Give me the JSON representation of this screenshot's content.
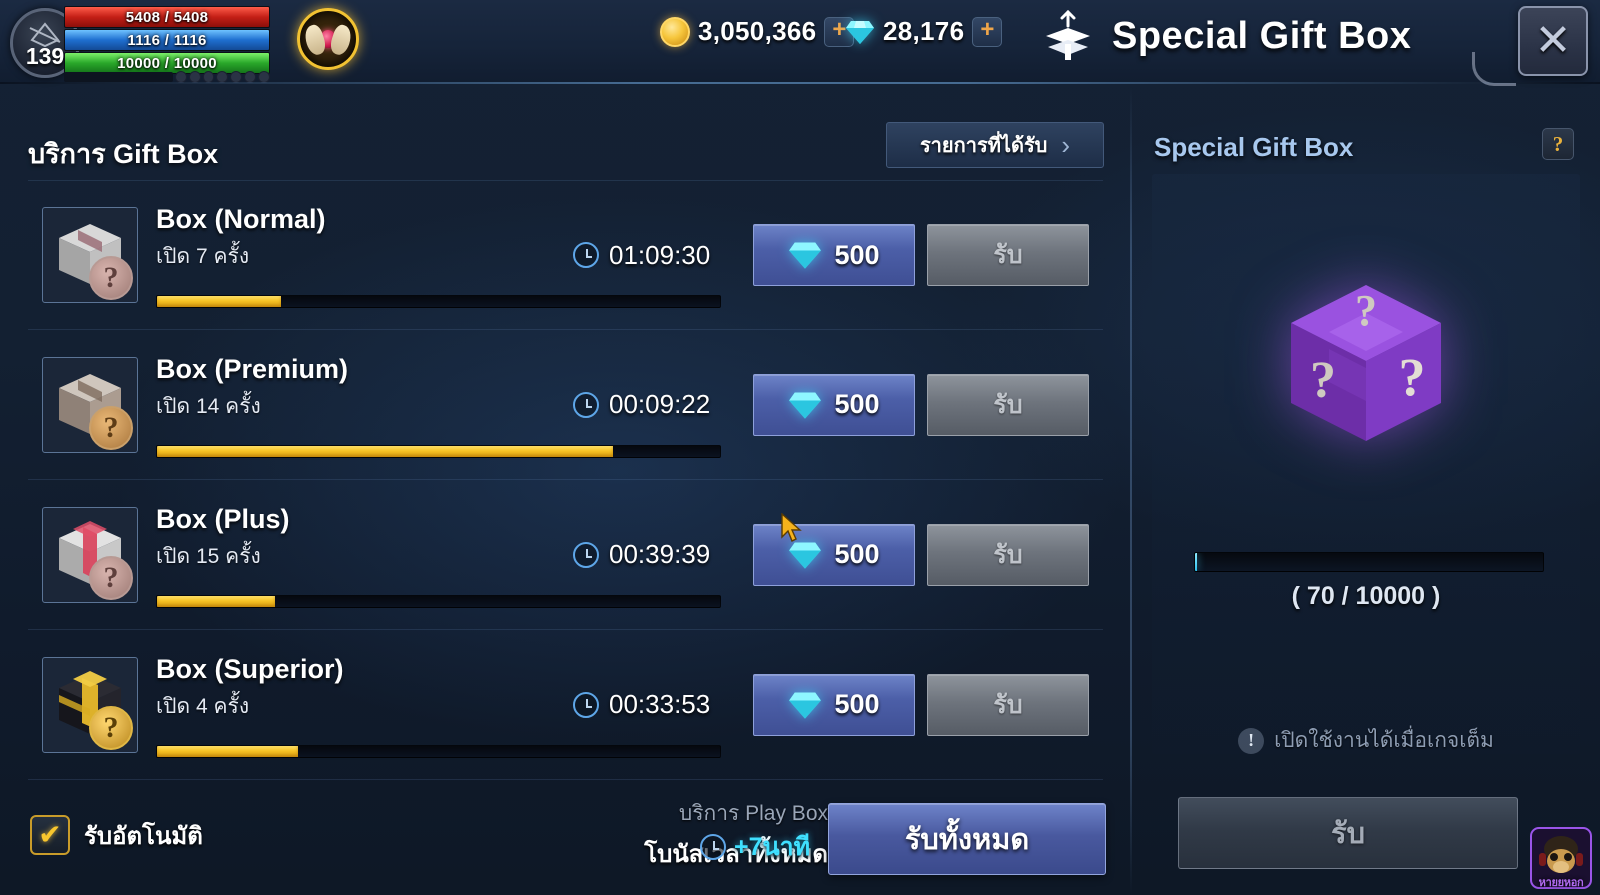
{
  "topbar": {
    "player": {
      "level": "139",
      "hp": "5408 / 5408",
      "mp": "1116 / 1116",
      "xp": "10000 / 10000"
    },
    "currencies": [
      {
        "name": "gold",
        "icon": "coin-icon",
        "value": "3,050,366",
        "plus": "+"
      },
      {
        "name": "gem",
        "icon": "gem-icon",
        "value": "28,176",
        "plus": "+"
      }
    ],
    "window_title": "Special Gift Box",
    "window_icon": "gift-box-icon",
    "close_label": "✕"
  },
  "left": {
    "section_title": "บริการ Gift Box",
    "history_button": "รายการที่ได้รับ",
    "history_chevron": "›",
    "rows": [
      {
        "name": "Box (Normal)",
        "sub": "เปิด 7 ครั้ง",
        "timer": "01:09:30",
        "price": "500",
        "claim": "รับ",
        "progress": 22,
        "box_color": "normal"
      },
      {
        "name": "Box (Premium)",
        "sub": "เปิด 14 ครั้ง",
        "timer": "00:09:22",
        "price": "500",
        "claim": "รับ",
        "progress": 81,
        "box_color": "premium"
      },
      {
        "name": "Box (Plus)",
        "sub": "เปิด 15 ครั้ง",
        "timer": "00:39:39",
        "price": "500",
        "claim": "รับ",
        "progress": 21,
        "box_color": "plus"
      },
      {
        "name": "Box (Superior)",
        "sub": "เปิด 4 ครั้ง",
        "timer": "00:33:53",
        "price": "500",
        "claim": "รับ",
        "progress": 25,
        "box_color": "superior"
      }
    ],
    "footer": {
      "auto_claim_label": "รับอัตโนมัติ",
      "auto_claim_checked": "✔",
      "bonus_line1": "บริการ Play Box",
      "bonus_line2": "โบนัสเวลาทั้งหมด",
      "bonus_time": "+7นาที",
      "claim_all_label": "รับทั้งหมด"
    }
  },
  "right": {
    "title": "Special Gift Box",
    "help_label": "?",
    "item_icon": "mystery-cube-icon",
    "gauge": {
      "current": "70",
      "max": "10000",
      "percent": 0.7,
      "display": "( 70 / 10000 )"
    },
    "note": "เปิดใช้งานได้เมื่อเกจเต็ม",
    "note_icon": "!",
    "claim_label": "รับ"
  },
  "watermark": {
    "text": "หายยหอก"
  },
  "colors": {
    "accent_blue": "#4c5fa8",
    "gold": "#f6c224",
    "cyan": "#3fe0ff",
    "purple": "#8a3fd0",
    "disabled_grey": "#6e747d"
  }
}
